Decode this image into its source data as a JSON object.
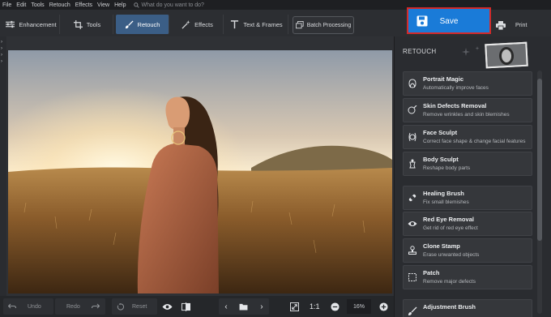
{
  "menu": {
    "items": [
      "File",
      "Edit",
      "Tools",
      "Retouch",
      "Effects",
      "View",
      "Help"
    ],
    "search_placeholder": "What do you want to do?"
  },
  "toolbar": {
    "tabs": [
      {
        "label": "Enhancement",
        "icon": "sliders-icon"
      },
      {
        "label": "Tools",
        "icon": "crop-icon"
      },
      {
        "label": "Retouch",
        "icon": "brush-icon",
        "active": true
      },
      {
        "label": "Effects",
        "icon": "magic-wand-icon"
      },
      {
        "label": "Text & Frames",
        "icon": "text-icon"
      }
    ],
    "batch_label": "Batch Processing",
    "save_label": "Save",
    "print_label": "Print"
  },
  "panel": {
    "title": "RETOUCH",
    "tools": [
      {
        "name": "Portrait Magic",
        "desc": "Automatically improve faces",
        "icon": "portrait-icon"
      },
      {
        "name": "Skin Defects Removal",
        "desc": "Remove wrinkles and skin blemishes",
        "icon": "face-brush-icon"
      },
      {
        "name": "Face Sculpt",
        "desc": "Correct face shape & change facial features",
        "icon": "face-sculpt-icon"
      },
      {
        "name": "Body Sculpt",
        "desc": "Reshape body parts",
        "icon": "body-icon"
      },
      {
        "name": "Healing Brush",
        "desc": "Fix small blemishes",
        "icon": "bandage-icon"
      },
      {
        "name": "Red Eye Removal",
        "desc": "Get rid of red eye effect",
        "icon": "eye-icon"
      },
      {
        "name": "Clone Stamp",
        "desc": "Erase unwanted objects",
        "icon": "stamp-icon"
      },
      {
        "name": "Patch",
        "desc": "Remove major defects",
        "icon": "patch-icon"
      },
      {
        "name": "Adjustment Brush",
        "desc": "",
        "icon": "adjust-brush-icon"
      }
    ]
  },
  "bottom": {
    "undo_label": "Undo",
    "redo_label": "Redo",
    "reset_label": "Reset",
    "fit_label": "1:1",
    "zoom_value": "16%"
  }
}
